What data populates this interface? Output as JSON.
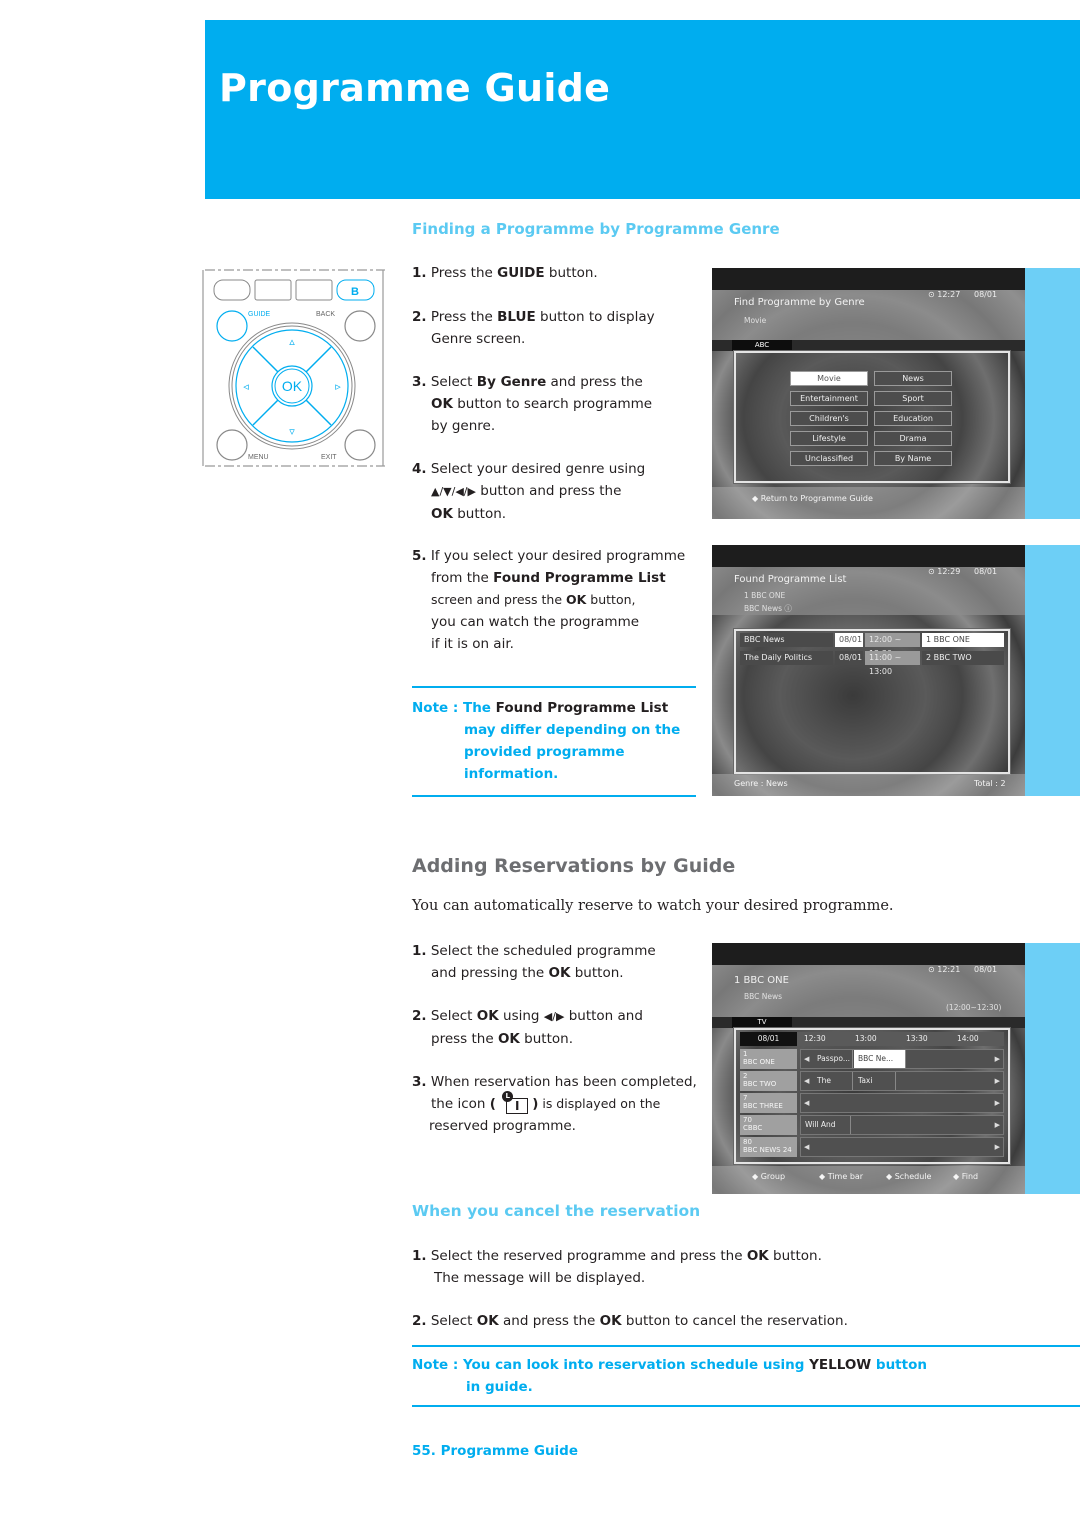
{
  "page": {
    "title": "Programme Guide",
    "footer": "55. Programme Guide",
    "colors": {
      "brand_blue": "#00adef",
      "light_blue": "#6dcff6",
      "heading_blue": "#5bcaf2",
      "heading_grey": "#6d6e71"
    }
  },
  "remote": {
    "blue_button_label": "B",
    "guide_label": "GUIDE",
    "back_label": "BACK",
    "ok_label": "OK",
    "menu_label": "MENU",
    "exit_label": "EXIT",
    "up_arrow": "▵",
    "down_arrow": "▿",
    "left_arrow": "◃",
    "right_arrow": "▹"
  },
  "section1": {
    "heading": "Finding a Programme by Programme Genre",
    "steps": [
      {
        "num": "1.",
        "parts": [
          "Press the ",
          "GUIDE",
          " button."
        ]
      },
      {
        "num": "2.",
        "line1": [
          "Press the ",
          "BLUE",
          " button to display"
        ],
        "line2": "Genre screen."
      },
      {
        "num": "3.",
        "line1": [
          "Select ",
          "By Genre",
          " and press the"
        ],
        "line2": [
          "OK",
          " button to search programme"
        ],
        "line3": "by genre."
      },
      {
        "num": "4.",
        "line1": "Select your desired genre using",
        "line2": [
          "▲/▼/◀/▶",
          " button and press the"
        ],
        "line3": [
          "OK",
          " button."
        ]
      },
      {
        "num": "5.",
        "line1": "If you select your desired programme",
        "line2": [
          "from the ",
          "Found Programme List"
        ],
        "line3": [
          "screen and press the ",
          "OK",
          " button,"
        ],
        "line4": "you can watch the programme",
        "line5": "if it is on air."
      }
    ],
    "note": {
      "prefix": "Note : The ",
      "bold": "Found Programme List",
      "line2": "may differ depending on the",
      "line3": "provided programme",
      "line4": "information."
    }
  },
  "screen_genre": {
    "title": "Find Programme by Genre",
    "subtitle": "Movie",
    "clock": "⊙ 12:27",
    "date": "08/01",
    "tab": "ABC",
    "genres": [
      "Movie",
      "News",
      "Entertainment",
      "Sport",
      "Children's",
      "Education",
      "Lifestyle",
      "Drama",
      "Unclassified",
      "By Name"
    ],
    "selected_genre": "Movie",
    "footer": "◆ Return to Programme Guide"
  },
  "screen_found": {
    "title": "Found Programme List",
    "channel": "1  BBC ONE",
    "programme": "BBC News ⓘ",
    "clock": "⊙ 12:29",
    "date": "08/01",
    "rows": [
      {
        "name": "BBC News",
        "date": "08/01",
        "time": "12:00 ~ 12:30",
        "channel": "1  BBC ONE"
      },
      {
        "name": "The Daily Politics",
        "date": "08/01",
        "time": "11:00 ~ 13:00",
        "channel": "2  BBC TWO"
      }
    ],
    "genre_label": "Genre : News",
    "total_label": "Total : 2"
  },
  "section2": {
    "heading": "Adding Reservations by Guide",
    "intro": "You can automatically reserve to watch your desired programme.",
    "steps": [
      {
        "num": "1.",
        "line1": "Select the scheduled programme",
        "line2": [
          "and pressing the ",
          "OK",
          " button."
        ]
      },
      {
        "num": "2.",
        "line1": [
          "Select ",
          "OK",
          " using ",
          "◀/▶",
          " button and"
        ],
        "line2": [
          "press the ",
          "OK",
          " button."
        ]
      },
      {
        "num": "3.",
        "line1": "When reservation has been completed,",
        "line2_pre": "the icon ",
        "line2_open": "(",
        "line2_close": ")",
        "line2_post": " is displayed on the",
        "line3": "reserved programme."
      }
    ]
  },
  "screen_guide": {
    "channel": "1 BBC ONE",
    "programme": "BBC News",
    "clock": "⊙ 12:21",
    "date": "08/01",
    "time_range": "(12:00~12:30)",
    "tab": "TV",
    "header": [
      "08/01",
      "12:30",
      "13:00",
      "13:30",
      "14:00"
    ],
    "rows": [
      {
        "num": "1",
        "name": "BBC ONE",
        "cells": [
          "Passpo...",
          "BBC Ne..."
        ]
      },
      {
        "num": "2",
        "name": "BBC TWO",
        "cells": [
          "The Dai...",
          "Taxi"
        ]
      },
      {
        "num": "7",
        "name": "BBC THREE",
        "cells": []
      },
      {
        "num": "70",
        "name": "CBBC",
        "cells": [
          "Will And G..."
        ]
      },
      {
        "num": "80",
        "name": "BBC NEWS 24",
        "cells": []
      }
    ],
    "footer": [
      "◆ Group",
      "◆ Time bar",
      "◆ Schedule",
      "◆ Find"
    ]
  },
  "section3": {
    "heading": "When you cancel the reservation",
    "steps": [
      {
        "num": "1.",
        "line1": [
          "Select the reserved programme and press the ",
          "OK",
          " button."
        ],
        "line2": "The message will be displayed."
      },
      {
        "num": "2.",
        "line1": [
          "Select ",
          "OK",
          " and press the ",
          "OK",
          " button to cancel the reservation."
        ]
      }
    ],
    "note": {
      "prefix": "Note : You can look into reservation schedule using ",
      "bold": "YELLOW",
      "suffix": " button",
      "line2": "in guide."
    }
  }
}
